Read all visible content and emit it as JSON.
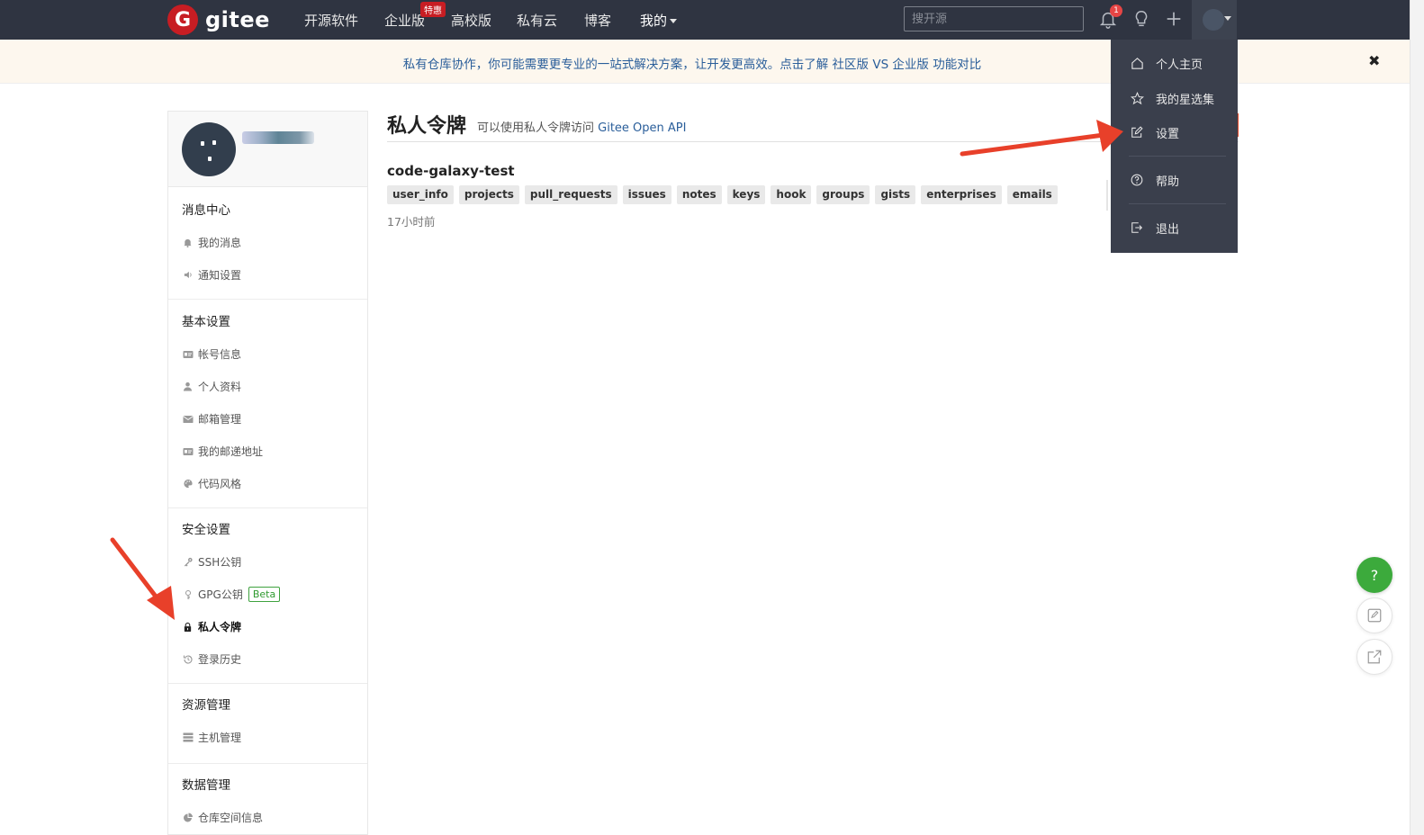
{
  "nav": {
    "brand": "gitee",
    "items": [
      "开源软件",
      "企业版",
      "高校版",
      "私有云",
      "博客",
      "我的"
    ],
    "enterprise_badge": "特惠",
    "search_placeholder": "搜开源",
    "notification_count": "1"
  },
  "banner": {
    "text_prefix": "私有仓库协作，你可能需要更专业的一站式解决方案，让开发更高效。点击了解 ",
    "link": "社区版 VS 企业版 功能对比",
    "close": "✖"
  },
  "sidebar": {
    "groups": [
      {
        "title": "消息中心",
        "items": [
          {
            "label": "我的消息",
            "icon": "bell-icon"
          },
          {
            "label": "通知设置",
            "icon": "speaker-icon"
          }
        ]
      },
      {
        "title": "基本设置",
        "items": [
          {
            "label": "帐号信息",
            "icon": "id-card-icon"
          },
          {
            "label": "个人资料",
            "icon": "user-icon"
          },
          {
            "label": "邮箱管理",
            "icon": "envelope-icon"
          },
          {
            "label": "我的邮递地址",
            "icon": "address-card-icon"
          },
          {
            "label": "代码风格",
            "icon": "palette-icon"
          }
        ]
      },
      {
        "title": "安全设置",
        "items": [
          {
            "label": "SSH公钥",
            "icon": "key-icon"
          },
          {
            "label": "GPG公钥",
            "icon": "gpg-key-icon",
            "badge": "Beta"
          },
          {
            "label": "私人令牌",
            "icon": "lock-icon",
            "active": true
          },
          {
            "label": "登录历史",
            "icon": "history-icon"
          }
        ]
      },
      {
        "title": "资源管理",
        "items": [
          {
            "label": "主机管理",
            "icon": "server-icon"
          }
        ]
      },
      {
        "title": "数据管理",
        "items": [
          {
            "label": "仓库空间信息",
            "icon": "pie-icon"
          }
        ]
      }
    ]
  },
  "main": {
    "title": "私人令牌",
    "subtitle_prefix": "可以使用私人令牌访问 ",
    "subtitle_link": "Gitee Open API",
    "token": {
      "name": "code-galaxy-test",
      "scopes": [
        "user_info",
        "projects",
        "pull_requests",
        "issues",
        "notes",
        "keys",
        "hook",
        "groups",
        "gists",
        "enterprises",
        "emails"
      ],
      "time": "17小时前"
    }
  },
  "dropdown": {
    "items": [
      {
        "label": "个人主页",
        "icon": "home-icon"
      },
      {
        "label": "我的星选集",
        "icon": "star-icon"
      },
      {
        "label": "设置",
        "icon": "edit-icon"
      },
      {
        "label": "帮助",
        "icon": "help-circle-icon"
      },
      {
        "label": "退出",
        "icon": "logout-icon"
      }
    ]
  },
  "floating": {
    "help": "?"
  },
  "colors": {
    "navbar": "#2f3441",
    "brand_red": "#c71d23",
    "accent_green": "#3caa3c",
    "arrow_red": "#e8402a"
  }
}
